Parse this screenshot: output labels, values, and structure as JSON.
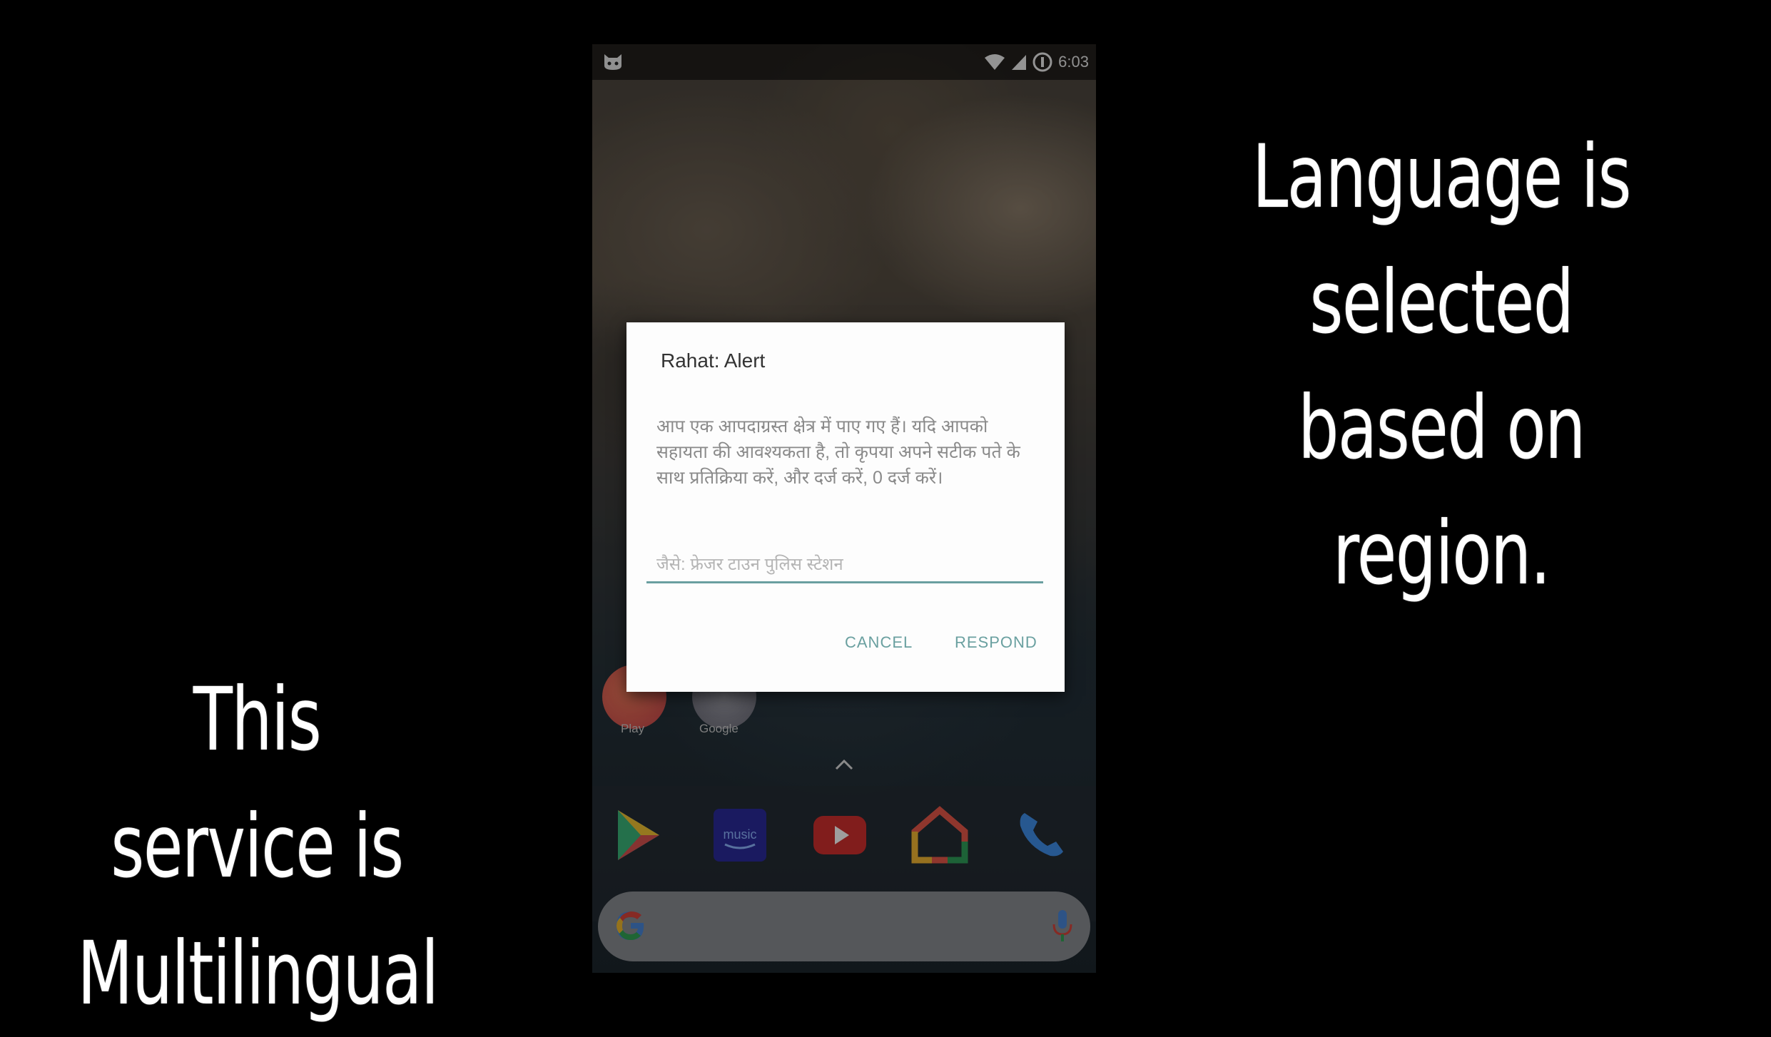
{
  "captions": {
    "right": [
      "Language is",
      "selected",
      "based on region."
    ],
    "left": [
      "This service is",
      "Multilingual"
    ]
  },
  "statusbar": {
    "time": "6:03"
  },
  "homescreen": {
    "app_labels": [
      "Play",
      "Google"
    ]
  },
  "dialog": {
    "title": "Rahat: Alert",
    "message": "आप एक आपदाग्रस्त क्षेत्र में पाए गए हैं। यदि आपको सहायता की आवश्यकता है, तो कृपया अपने सटीक पते के साथ प्रतिक्रिया करें, और दर्ज करें, 0 दर्ज करें।",
    "input_placeholder": "जैसे: फ्रेजर टाउन पुलिस स्टेशन",
    "cancel_label": "CANCEL",
    "respond_label": "RESPOND"
  },
  "colors": {
    "accent": "#6aa0a0",
    "background": "#000000",
    "dialog_bg": "#fdfdfd"
  },
  "icons": {
    "dock": [
      "play-store-icon",
      "amazon-music-icon",
      "youtube-icon",
      "google-home-icon",
      "phone-icon"
    ],
    "search": [
      "google-g-icon",
      "microphone-icon"
    ]
  }
}
